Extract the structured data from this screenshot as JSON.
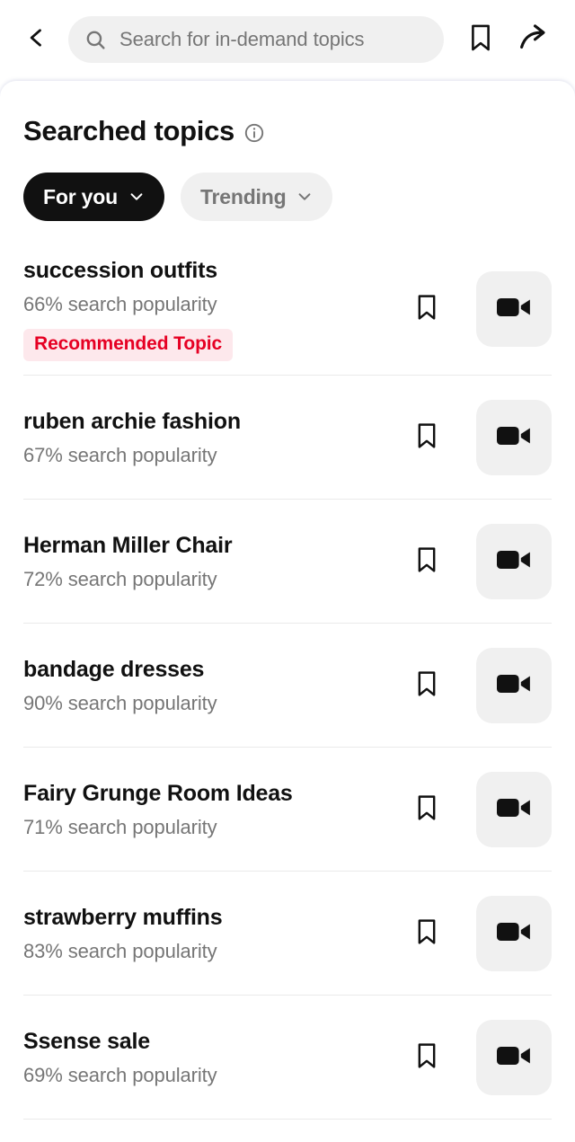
{
  "topbar": {
    "back_icon": "back-chevron-icon",
    "search": {
      "icon": "search-icon",
      "value": "",
      "placeholder": "Search for in-demand topics"
    },
    "bookmark_icon": "bookmark-icon",
    "share_icon": "share-icon"
  },
  "sheet": {
    "title": "Searched topics",
    "info_icon": "info-icon",
    "chips": [
      {
        "label": "For you",
        "selected": true,
        "caret": "chevron-down-icon"
      },
      {
        "label": "Trending",
        "selected": false,
        "caret": "chevron-down-icon"
      }
    ],
    "topics": [
      {
        "name": "succession outfits",
        "popularity": "66% search popularity",
        "badge": "Recommended Topic",
        "save_icon": "bookmark-icon",
        "video_icon": "video-camera-icon"
      },
      {
        "name": "ruben archie fashion",
        "popularity": "67% search popularity",
        "badge": "",
        "save_icon": "bookmark-icon",
        "video_icon": "video-camera-icon"
      },
      {
        "name": "Herman Miller Chair",
        "popularity": "72% search popularity",
        "badge": "",
        "save_icon": "bookmark-icon",
        "video_icon": "video-camera-icon"
      },
      {
        "name": "bandage dresses",
        "popularity": "90% search popularity",
        "badge": "",
        "save_icon": "bookmark-icon",
        "video_icon": "video-camera-icon"
      },
      {
        "name": "Fairy Grunge Room Ideas",
        "popularity": "71% search popularity",
        "badge": "",
        "save_icon": "bookmark-icon",
        "video_icon": "video-camera-icon"
      },
      {
        "name": "strawberry muffins",
        "popularity": "83% search popularity",
        "badge": "",
        "save_icon": "bookmark-icon",
        "video_icon": "video-camera-icon"
      },
      {
        "name": "Ssense sale",
        "popularity": "69% search popularity",
        "badge": "",
        "save_icon": "bookmark-icon",
        "video_icon": "video-camera-icon"
      }
    ]
  },
  "colors": {
    "accent": "#e60023",
    "badge_bg": "#fde8ec",
    "chip_selected_bg": "#111111",
    "chip_bg": "#f0f0f0",
    "muted_text": "#767676"
  }
}
